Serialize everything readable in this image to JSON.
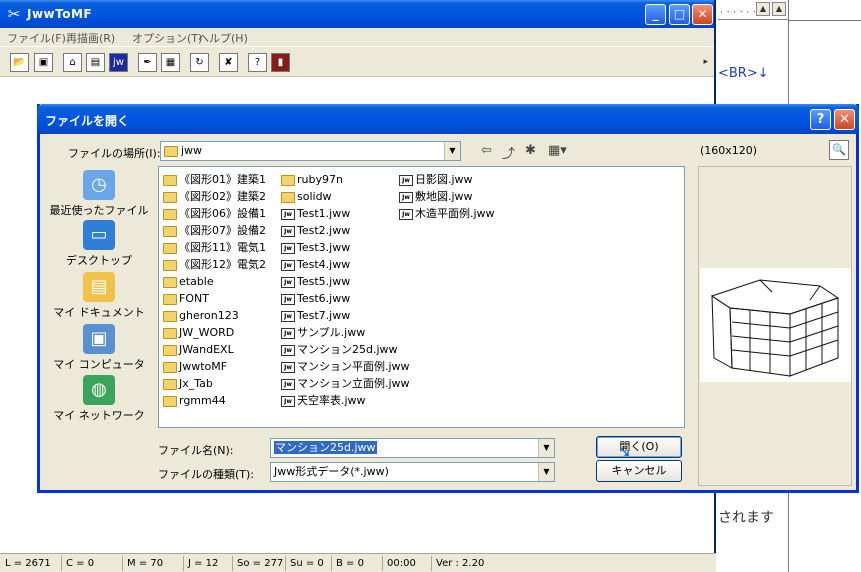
{
  "main": {
    "title": "JwwToMF",
    "menu": [
      "ファイル(F)",
      "再描画(R)",
      "オプション(T)",
      "ヘルプ(H)"
    ],
    "toolbar_icons": [
      "open-folder-icon",
      "save-icon",
      "folder-icon",
      "dwg-icon",
      "jw-icon",
      "pen-icon",
      "image-icon",
      "refresh-icon",
      "tools-icon",
      "help-icon",
      "exit-icon"
    ],
    "status": [
      "L = 2671",
      "C = 0",
      "M = 70",
      "J = 12",
      "So = 277",
      "Su = 0",
      "B = 0",
      "00:00",
      "Ver : 2.20"
    ]
  },
  "side": {
    "text_br": "<BR>↓",
    "text_masu": "されます"
  },
  "dialog": {
    "title": "ファイルを開く",
    "help_label": "?",
    "close_label": "✕",
    "location_label": "ファイルの場所(I):",
    "location_value": "jww",
    "places": [
      "最近使ったファイル",
      "デスクトップ",
      "マイ ドキュメント",
      "マイ コンピュータ",
      "マイ ネットワーク"
    ],
    "columns": [
      [
        {
          "name": "《図形01》建築1",
          "type": "folder"
        },
        {
          "name": "《図形02》建築2",
          "type": "folder"
        },
        {
          "name": "《図形06》設備1",
          "type": "folder"
        },
        {
          "name": "《図形07》設備2",
          "type": "folder"
        },
        {
          "name": "《図形11》電気1",
          "type": "folder"
        },
        {
          "name": "《図形12》電気2",
          "type": "folder"
        },
        {
          "name": "etable",
          "type": "folder"
        },
        {
          "name": "FONT",
          "type": "folder"
        },
        {
          "name": "gheron123",
          "type": "folder"
        },
        {
          "name": "JW_WORD",
          "type": "folder"
        },
        {
          "name": "JWandEXL",
          "type": "folder"
        },
        {
          "name": "JwwtoMF",
          "type": "folder"
        },
        {
          "name": "Jx_Tab",
          "type": "folder"
        },
        {
          "name": "rgmm44",
          "type": "folder"
        }
      ],
      [
        {
          "name": "ruby97n",
          "type": "folder"
        },
        {
          "name": "solidw",
          "type": "folder"
        },
        {
          "name": "Test1.jww",
          "type": "jww"
        },
        {
          "name": "Test2.jww",
          "type": "jww"
        },
        {
          "name": "Test3.jww",
          "type": "jww"
        },
        {
          "name": "Test4.jww",
          "type": "jww"
        },
        {
          "name": "Test5.jww",
          "type": "jww"
        },
        {
          "name": "Test6.jww",
          "type": "jww"
        },
        {
          "name": "Test7.jww",
          "type": "jww"
        },
        {
          "name": "サンプル.jww",
          "type": "jww"
        },
        {
          "name": "マンション25d.jww",
          "type": "jww"
        },
        {
          "name": "マンション平面例.jww",
          "type": "jww"
        },
        {
          "name": "マンション立面例.jww",
          "type": "jww"
        },
        {
          "name": "天空率表.jww",
          "type": "jww"
        }
      ],
      [
        {
          "name": "日影図.jww",
          "type": "jww"
        },
        {
          "name": "敷地図.jww",
          "type": "jww"
        },
        {
          "name": "木造平面例.jww",
          "type": "jww"
        }
      ]
    ],
    "filename_label": "ファイル名(N):",
    "filename_value": "マンション25d.jww",
    "filetype_label": "ファイルの種類(T):",
    "filetype_value": "Jww形式データ(*.jww)",
    "open_button": "開く(O)",
    "cancel_button": "キャンセル",
    "preview_size": "(160x120)"
  }
}
